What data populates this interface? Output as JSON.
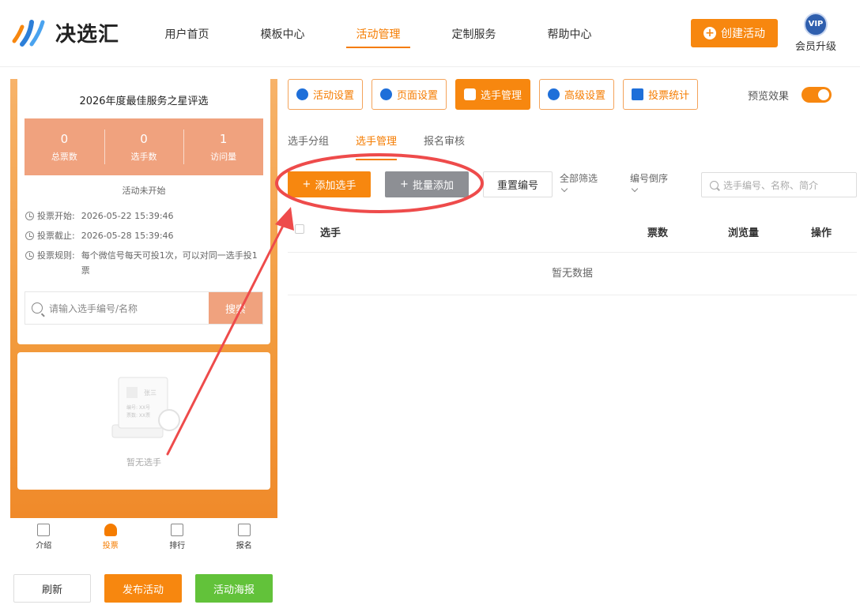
{
  "brand": {
    "logo_text": "决选汇",
    "accent": "#f7870f"
  },
  "nav": {
    "items": [
      "用户首页",
      "模板中心",
      "活动管理",
      "定制服务",
      "帮助中心"
    ],
    "active_index": 2
  },
  "header": {
    "create_label": "创建活动",
    "vip_badge": "VIP",
    "vip_label": "会员升级"
  },
  "preview": {
    "title": "2026年度最佳服务之星评选",
    "stats": [
      {
        "value": "0",
        "label": "总票数"
      },
      {
        "value": "0",
        "label": "选手数"
      },
      {
        "value": "1",
        "label": "访问量"
      }
    ],
    "status": "活动未开始",
    "info": [
      {
        "key": "投票开始:",
        "value": "2026-05-22 15:39:46"
      },
      {
        "key": "投票截止:",
        "value": "2026-05-28 15:39:46"
      },
      {
        "key": "投票规则:",
        "value": "每个微信号每天可投1次，可以对同一选手投1票"
      }
    ],
    "search_placeholder": "请输入选手编号/名称",
    "search_button": "搜索",
    "illus_name": "张三",
    "illus_line1": "编号: XX号",
    "illus_line2": "票数: XX票",
    "empty_text": "暂无选手",
    "tabs": [
      {
        "label": "介绍",
        "icon": "doc-icon"
      },
      {
        "label": "投票",
        "icon": "person-icon"
      },
      {
        "label": "排行",
        "icon": "bar-chart-icon"
      },
      {
        "label": "报名",
        "icon": "signup-icon"
      }
    ],
    "active_tab": 1
  },
  "bottom_buttons": {
    "refresh": "刷新",
    "publish": "发布活动",
    "poster": "活动海报"
  },
  "settings_tabs": [
    {
      "label": "活动设置",
      "icon": "star-icon"
    },
    {
      "label": "页面设置",
      "icon": "gear-icon"
    },
    {
      "label": "选手管理",
      "icon": "users-icon"
    },
    {
      "label": "高级设置",
      "icon": "sliders-icon"
    },
    {
      "label": "投票统计",
      "icon": "stats-icon"
    }
  ],
  "settings_active": 2,
  "preview_toggle": {
    "label": "预览效果",
    "on": true
  },
  "sub_tabs": [
    "选手分组",
    "选手管理",
    "报名审核"
  ],
  "sub_active": 1,
  "toolbar": {
    "add": "添加选手",
    "batch": "批量添加",
    "reset": "重置编号",
    "filter": "全部筛选",
    "sort": "编号倒序",
    "search_placeholder": "选手编号、名称、简介"
  },
  "table": {
    "columns": [
      "选手",
      "票数",
      "浏览量",
      "操作"
    ],
    "empty": "暂无数据"
  },
  "annotation_color": "#ee4b4b"
}
